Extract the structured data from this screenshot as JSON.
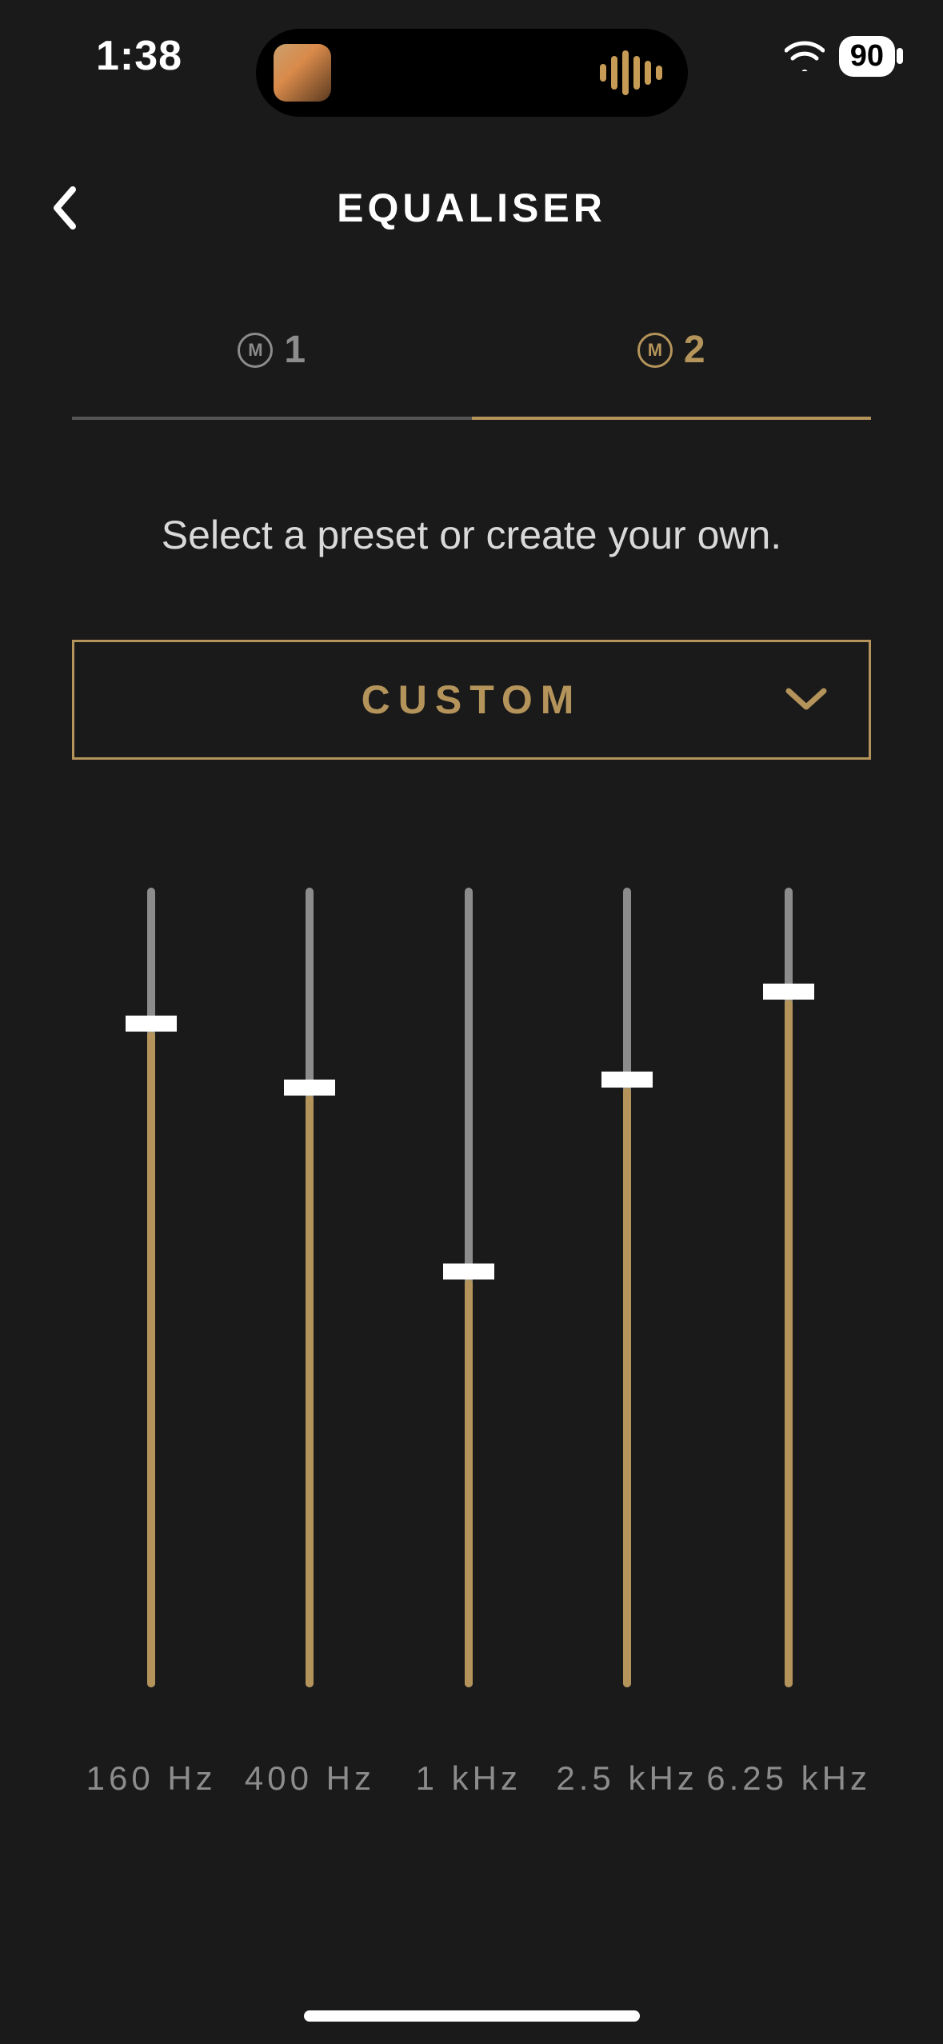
{
  "status": {
    "time": "1:38",
    "battery": "90"
  },
  "header": {
    "title": "EQUALISER"
  },
  "tabs": [
    {
      "badge": "M",
      "label": "1",
      "active": false
    },
    {
      "badge": "M",
      "label": "2",
      "active": true
    }
  ],
  "subtitle": "Select a preset or create your own.",
  "preset": {
    "selected": "CUSTOM"
  },
  "bands": [
    {
      "label": "160 Hz",
      "pct": 82
    },
    {
      "label": "400 Hz",
      "pct": 74
    },
    {
      "label": "1 kHz",
      "pct": 51
    },
    {
      "label": "2.5 kHz",
      "pct": 75
    },
    {
      "label": "6.25 kHz",
      "pct": 86
    }
  ],
  "colors": {
    "accent": "#b4945a",
    "bg": "#1a1a1a",
    "muted": "#8c8c8c"
  }
}
